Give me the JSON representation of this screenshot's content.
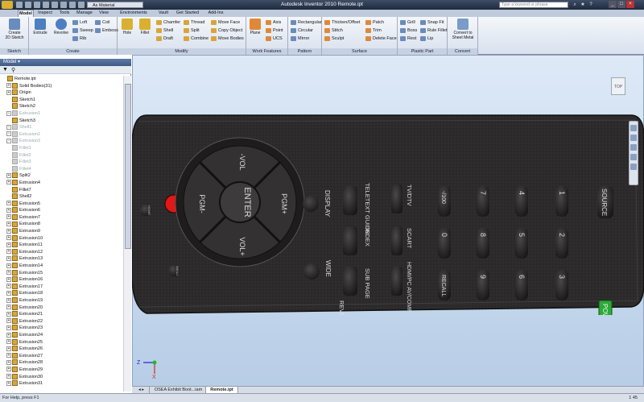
{
  "titlebar": {
    "material": "As Material",
    "title": "Autodesk Inventor 2010    Remote.ipt",
    "search_placeholder": "Type a keyword or phrase"
  },
  "tabs": [
    "Model",
    "Inspect",
    "Tools",
    "Manage",
    "View",
    "Environments",
    "Vault",
    "Get Started",
    "Add-Ins"
  ],
  "ribbon": {
    "sketch": {
      "label": "Sketch",
      "create": "Create\n2D Sketch"
    },
    "create": {
      "label": "Create",
      "extrude": "Extrude",
      "revolve": "Revolve",
      "loft": "Loft",
      "sweep": "Sweep",
      "rib": "Rib",
      "coil": "Coil",
      "emboss": "Emboss"
    },
    "modify": {
      "label": "Modify",
      "hole": "Hole",
      "fillet": "Fillet",
      "chamfer": "Chamfer",
      "shell": "Shell",
      "draft": "Draft",
      "thread": "Thread",
      "split": "Split",
      "combine": "Combine",
      "move_face": "Move Face",
      "copy_object": "Copy Object",
      "move_bodies": "Move Bodies"
    },
    "work": {
      "label": "Work Features",
      "plane": "Plane",
      "axis": "Axis",
      "point": "Point",
      "ucs": "UCS"
    },
    "pattern": {
      "label": "Pattern",
      "rectangular": "Rectangular",
      "circular": "Circular",
      "mirror": "Mirror"
    },
    "surface": {
      "label": "Surface",
      "thicken": "Thicken/Offset",
      "stitch": "Stitch",
      "sculpt": "Sculpt",
      "patch": "Patch",
      "trim": "Trim",
      "delete_face": "Delete Face"
    },
    "plastic": {
      "label": "Plastic Part",
      "grill": "Grill",
      "boss": "Boss",
      "rest": "Rest",
      "snap_fit": "Snap Fit",
      "rule_fillet": "Rule Fillet",
      "lip": "Lip"
    },
    "convert": {
      "label": "Convert",
      "sheet_metal": "Convert to\nSheet Metal"
    }
  },
  "browser": {
    "title": "Model ▾",
    "items": [
      {
        "label": "Remote.ipt",
        "exp": "",
        "indent": 0,
        "dim": false
      },
      {
        "label": "Solid Bodies(31)",
        "exp": "+",
        "indent": 1,
        "dim": false
      },
      {
        "label": "Origin",
        "exp": "+",
        "indent": 1,
        "dim": false
      },
      {
        "label": "Sketch1",
        "exp": "",
        "indent": 1,
        "dim": false
      },
      {
        "label": "Sketch2",
        "exp": "",
        "indent": 1,
        "dim": false
      },
      {
        "label": "Extrusion1",
        "exp": "+",
        "indent": 1,
        "dim": true
      },
      {
        "label": "Sketch3",
        "exp": "",
        "indent": 1,
        "dim": false
      },
      {
        "label": "Shell1",
        "exp": "+",
        "indent": 1,
        "dim": true
      },
      {
        "label": "Extrusion2",
        "exp": "+",
        "indent": 1,
        "dim": true
      },
      {
        "label": "Extrusion3",
        "exp": "+",
        "indent": 1,
        "dim": true
      },
      {
        "label": "Fillet1",
        "exp": "",
        "indent": 1,
        "dim": true
      },
      {
        "label": "Fillet2",
        "exp": "",
        "indent": 1,
        "dim": true
      },
      {
        "label": "Fillet3",
        "exp": "",
        "indent": 1,
        "dim": true
      },
      {
        "label": "Fillet4",
        "exp": "",
        "indent": 1,
        "dim": true
      },
      {
        "label": "Split2",
        "exp": "+",
        "indent": 1,
        "dim": false
      },
      {
        "label": "Extrusion4",
        "exp": "+",
        "indent": 1,
        "dim": false
      },
      {
        "label": "Fillet7",
        "exp": "",
        "indent": 1,
        "dim": false
      },
      {
        "label": "Shell2",
        "exp": "",
        "indent": 1,
        "dim": false
      },
      {
        "label": "Extrusion5",
        "exp": "+",
        "indent": 1,
        "dim": false
      },
      {
        "label": "Extrusion6",
        "exp": "+",
        "indent": 1,
        "dim": false
      },
      {
        "label": "Extrusion7",
        "exp": "+",
        "indent": 1,
        "dim": false
      },
      {
        "label": "Extrusion8",
        "exp": "+",
        "indent": 1,
        "dim": false
      },
      {
        "label": "Extrusion9",
        "exp": "+",
        "indent": 1,
        "dim": false
      },
      {
        "label": "Extrusion10",
        "exp": "+",
        "indent": 1,
        "dim": false
      },
      {
        "label": "Extrusion11",
        "exp": "+",
        "indent": 1,
        "dim": false
      },
      {
        "label": "Extrusion12",
        "exp": "+",
        "indent": 1,
        "dim": false
      },
      {
        "label": "Extrusion13",
        "exp": "+",
        "indent": 1,
        "dim": false
      },
      {
        "label": "Extrusion14",
        "exp": "+",
        "indent": 1,
        "dim": false
      },
      {
        "label": "Extrusion15",
        "exp": "+",
        "indent": 1,
        "dim": false
      },
      {
        "label": "Extrusion16",
        "exp": "+",
        "indent": 1,
        "dim": false
      },
      {
        "label": "Extrusion17",
        "exp": "+",
        "indent": 1,
        "dim": false
      },
      {
        "label": "Extrusion18",
        "exp": "+",
        "indent": 1,
        "dim": false
      },
      {
        "label": "Extrusion19",
        "exp": "+",
        "indent": 1,
        "dim": false
      },
      {
        "label": "Extrusion20",
        "exp": "+",
        "indent": 1,
        "dim": false
      },
      {
        "label": "Extrusion21",
        "exp": "+",
        "indent": 1,
        "dim": false
      },
      {
        "label": "Extrusion22",
        "exp": "+",
        "indent": 1,
        "dim": false
      },
      {
        "label": "Extrusion23",
        "exp": "+",
        "indent": 1,
        "dim": false
      },
      {
        "label": "Extrusion24",
        "exp": "+",
        "indent": 1,
        "dim": false
      },
      {
        "label": "Extrusion25",
        "exp": "+",
        "indent": 1,
        "dim": false
      },
      {
        "label": "Extrusion26",
        "exp": "+",
        "indent": 1,
        "dim": false
      },
      {
        "label": "Extrusion27",
        "exp": "+",
        "indent": 1,
        "dim": false
      },
      {
        "label": "Extrusion28",
        "exp": "+",
        "indent": 1,
        "dim": false
      },
      {
        "label": "Extrusion29",
        "exp": "+",
        "indent": 1,
        "dim": false
      },
      {
        "label": "Extrusion30",
        "exp": "+",
        "indent": 1,
        "dim": false
      },
      {
        "label": "Extrusion31",
        "exp": "+",
        "indent": 1,
        "dim": false
      }
    ]
  },
  "remote": {
    "display": "DISPLAY",
    "teletext_guide": "TELETEXT GUIDE",
    "index": "INDEX",
    "sub_page": "SUB PAGE",
    "reveal": "REVEAL",
    "wide": "WIDE",
    "tv_dtv": "TV/DTV",
    "scart": "SCART",
    "hdmi_pc": "HDMI/PC AV/COMP",
    "keys": [
      "-/100",
      "7",
      "4",
      "1",
      "0",
      "8",
      "5",
      "2",
      "RECALL",
      "9",
      "6",
      "3"
    ],
    "source": "SOURCE",
    "power": "POWER",
    "vol_plus": "VOL+",
    "vol_minus": "-VOL",
    "pgm_plus": "PGM+",
    "pgm_minus": "PGM-",
    "enter": "ENTER",
    "home": "HOME",
    "menu": "MENU",
    "viewcube": "TOP"
  },
  "doc_tabs": [
    "OSEA Exhibit Boot...iam",
    "Remote.ipt"
  ],
  "status": {
    "text": "For Help, press F1",
    "nums": "1    45"
  },
  "axis": {
    "x": "X",
    "y": "Y",
    "z": "Z"
  },
  "colors": {
    "power": "#2ea83a",
    "red_button": "#e01818",
    "body": "#2a2828"
  }
}
